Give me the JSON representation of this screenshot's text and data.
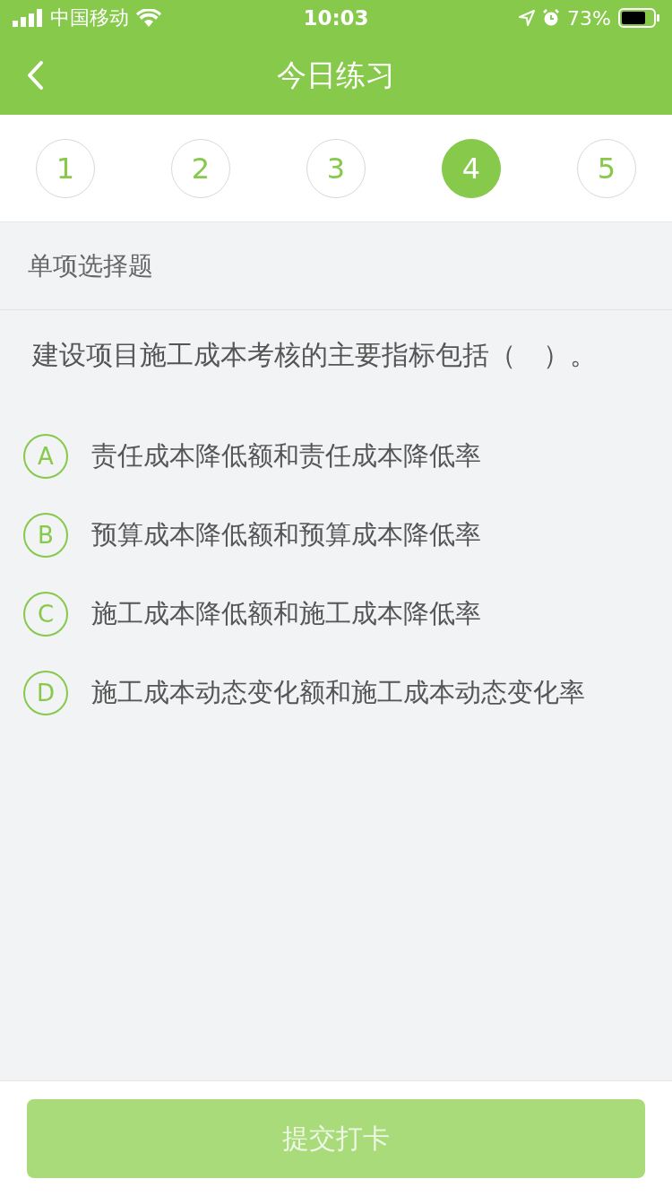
{
  "status_bar": {
    "carrier": "中国移动",
    "time": "10:03",
    "battery": "73%"
  },
  "nav": {
    "title": "今日练习"
  },
  "question_tabs": [
    {
      "label": "1",
      "selected": false
    },
    {
      "label": "2",
      "selected": false
    },
    {
      "label": "3",
      "selected": false
    },
    {
      "label": "4",
      "selected": true
    },
    {
      "label": "5",
      "selected": false
    }
  ],
  "section": {
    "title": "单项选择题"
  },
  "question": {
    "text": "建设项目施工成本考核的主要指标包括（　）。"
  },
  "options": [
    {
      "letter": "A",
      "text": "责任成本降低额和责任成本降低率",
      "selected": false
    },
    {
      "letter": "B",
      "text": "预算成本降低额和预算成本降低率",
      "selected": false
    },
    {
      "letter": "C",
      "text": "施工成本降低额和施工成本降低率",
      "selected": false
    },
    {
      "letter": "D",
      "text": "施工成本动态变化额和施工成本动态变化率",
      "selected": false
    }
  ],
  "submit": {
    "label": "提交打卡",
    "disabled": true
  }
}
